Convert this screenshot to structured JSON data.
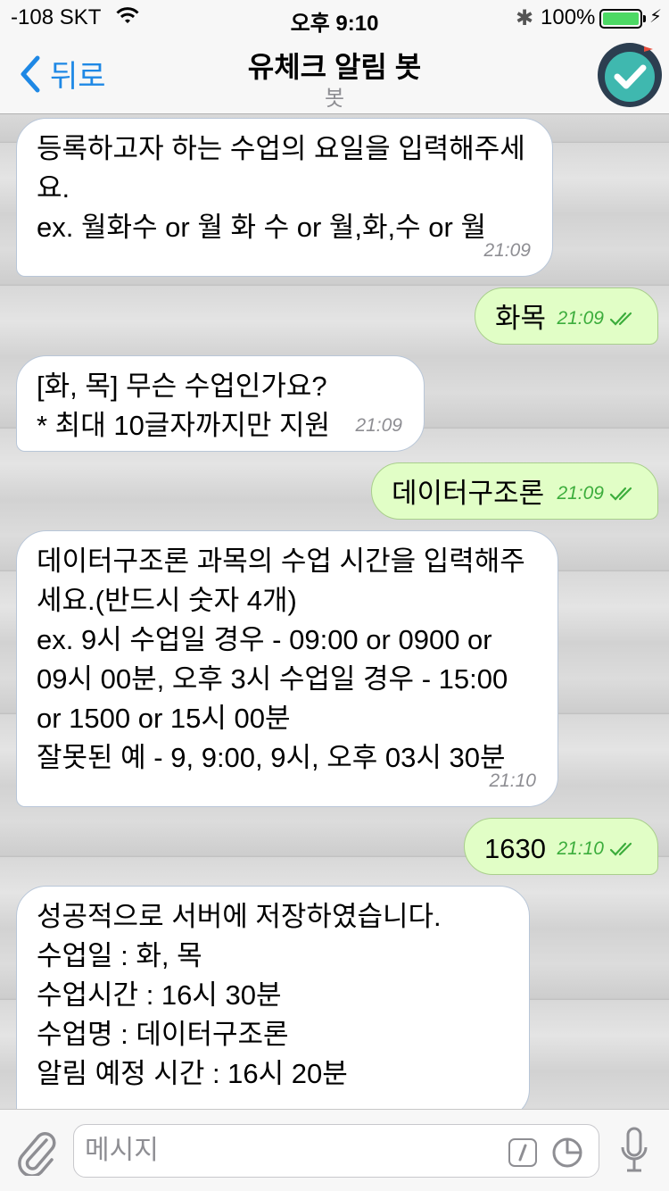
{
  "status_bar": {
    "carrier": "-108 SKT",
    "time": "오후 9:10",
    "battery_percent": "100%",
    "battery_level": 1.0
  },
  "nav": {
    "back_label": "뒤로",
    "title": "유체크 알림 봇",
    "subtitle": "봇"
  },
  "messages": [
    {
      "direction": "incoming",
      "text": "등록하고자 하는 수업의 요일을 입력해주세\n요.\nex. 월화수 or 월 화 수 or 월,화,수 or 월",
      "time": "21:09"
    },
    {
      "direction": "outgoing",
      "text": "화목",
      "time": "21:09",
      "read": true
    },
    {
      "direction": "incoming",
      "text": "[화, 목] 무슨 수업인가요?\n* 최대 10글자까지만 지원",
      "time": "21:09"
    },
    {
      "direction": "outgoing",
      "text": "데이터구조론",
      "time": "21:09",
      "read": true
    },
    {
      "direction": "incoming",
      "text": "데이터구조론 과목의 수업 시간을 입력해주\n세요.(반드시 숫자 4개)\nex. 9시 수업일 경우 - 09:00 or 0900 or\n09시 00분, 오후 3시 수업일 경우 - 15:00\nor 1500 or 15시 00분\n잘못된 예 - 9, 9:00, 9시, 오후 03시 30분",
      "time": "21:10"
    },
    {
      "direction": "outgoing",
      "text": "1630",
      "time": "21:10",
      "read": true
    },
    {
      "direction": "incoming",
      "text": "성공적으로 서버에 저장하였습니다.\n수업일 : 화, 목\n수업시간 : 16시 30분\n수업명 : 데이터구조론\n알림 예정 시간 : 16시 20분",
      "time": ""
    }
  ],
  "input": {
    "placeholder": "메시지",
    "value": ""
  },
  "colors": {
    "accent": "#1e88e5",
    "outgoing_bubble": "#e1fec6",
    "incoming_bubble": "#ffffff",
    "read_check": "#3cad3c",
    "avatar_bg": "#2c3e50",
    "avatar_circle": "#3fb8af",
    "battery": "#4cd964"
  },
  "icons": {
    "back": "chevron-left-icon",
    "wifi": "wifi-icon",
    "bluetooth": "bluetooth-icon",
    "attach": "paperclip-icon",
    "command": "slash-command-icon",
    "sticker": "sticker-icon",
    "mic": "microphone-icon",
    "avatar": "checkmark-avatar-icon"
  }
}
